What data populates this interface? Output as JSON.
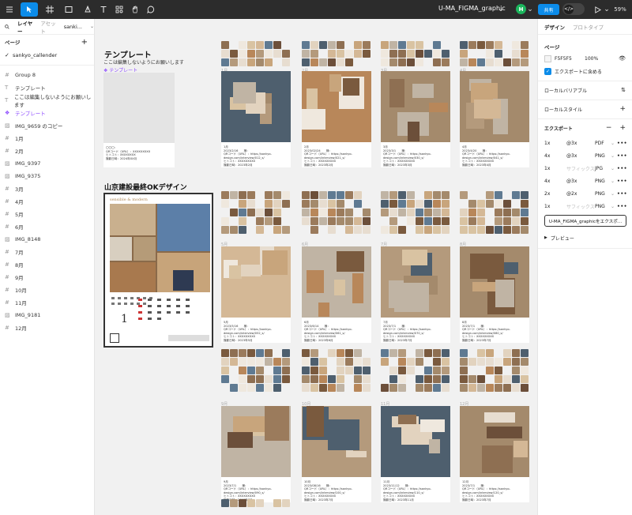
{
  "toolbar": {
    "title": "U-MA_FIGMA_graphic",
    "title_chevron": "⌄",
    "avatar_initial": "H",
    "share_label": "共有",
    "dev_mode_icon": "</>",
    "zoom": "59%",
    "tools": [
      "move-tool",
      "frame-tool",
      "shape-tool",
      "pen-tool",
      "text-tool",
      "resources-tool",
      "hand-tool",
      "comment-tool"
    ]
  },
  "left_panel": {
    "tab_layers": "レイヤー",
    "tab_assets": "アセット",
    "page_selector": "sanki...",
    "pages_header": "ページ",
    "pages": [
      "sankyo_callender"
    ],
    "layers": [
      {
        "icon": "frame",
        "label": "Group 8"
      },
      {
        "icon": "text",
        "label": "テンプレート"
      },
      {
        "icon": "text",
        "label": "ここは編集しないようにお願いします"
      },
      {
        "icon": "component",
        "label": "テンプレート"
      },
      {
        "icon": "image",
        "label": "IMG_9659 のコピー"
      },
      {
        "icon": "frame",
        "label": "1月"
      },
      {
        "icon": "frame",
        "label": "2月"
      },
      {
        "icon": "image",
        "label": "IMG_9397"
      },
      {
        "icon": "image",
        "label": "IMG_9375"
      },
      {
        "icon": "frame",
        "label": "3月"
      },
      {
        "icon": "frame",
        "label": "4月"
      },
      {
        "icon": "frame",
        "label": "5月"
      },
      {
        "icon": "frame",
        "label": "6月"
      },
      {
        "icon": "image",
        "label": "IMG_8148"
      },
      {
        "icon": "frame",
        "label": "7月"
      },
      {
        "icon": "frame",
        "label": "8月"
      },
      {
        "icon": "frame",
        "label": "9月"
      },
      {
        "icon": "frame",
        "label": "10月"
      },
      {
        "icon": "frame",
        "label": "11月"
      },
      {
        "icon": "image",
        "label": "IMG_9181"
      },
      {
        "icon": "frame",
        "label": "12月"
      }
    ]
  },
  "canvas": {
    "template_title": "テンプレート",
    "template_subtitle": "ここは編集しないようにお願いします",
    "template_component_label": "テンプレート",
    "template_info": [
      "〇〇〇：",
      "QRコード（URL）：XXXXXXXXX",
      "ヒトコト：XXXXXXXX",
      "撮影日時：2024年XX月"
    ],
    "final_design_title": "山京建設最終OKデザイン",
    "preview_brand": "sensible & modern",
    "preview_big_day": "1",
    "months": [
      {
        "label": "1月",
        "info": [
          "1月",
          "2023/2/16　　様：",
          "QRコード（URL）：https://sankyo-",
          "design.com/interview/012_s/",
          "ヒトコト：XXXXXXXXX",
          "撮影日時：2023年2月"
        ]
      },
      {
        "label": "2月",
        "info": [
          "2月",
          "2023/02/24　　様：",
          "QRコード（URL）：https://sankyo-",
          "design.com/interview/021_s/",
          "ヒトコト：XXXXXXXXX",
          "撮影日時：2023年2月"
        ]
      },
      {
        "label": "3月",
        "info": [
          "3月",
          "2023/3/1　　様：",
          "QRコード（URL）：https://sankyo-",
          "design.com/interview/030_s/",
          "ヒトコト：XXXXXXXXX",
          "撮影日時：2023年3月"
        ]
      },
      {
        "label": "4月",
        "info": [
          "4月",
          "2023/4/20　　様：",
          "QRコード（URL）：https://sankyo-",
          "design.com/interview/041_s/",
          "ヒトコト：XXXXXXXXX",
          "撮影日時：2023年4月"
        ]
      },
      {
        "label": "5月",
        "info": [
          "5月",
          "2023/5/16　　様：",
          "QRコード（URL）：https://sankyo-",
          "design.com/interview/052_s/",
          "ヒトコト：XXXXXXXXX",
          "撮影日時：2023年5月"
        ]
      },
      {
        "label": "6月",
        "info": [
          "6月",
          "2023/6/14　　様：",
          "QRコード（URL）：https://sankyo-",
          "design.com/interview/061_s/",
          "ヒトコト：XXXXXXXXX",
          "撮影日時：2023年6月"
        ]
      },
      {
        "label": "7月",
        "info": [
          "7月",
          "2023/7/1　　様：",
          "QRコード（URL）：https://sankyo-",
          "design.com/interview/070_s/",
          "ヒトコト：XXXXXXXXX",
          "撮影日時：2023年7月"
        ]
      },
      {
        "label": "8月",
        "info": [
          "8月",
          "2023/7/1　　様：",
          "QRコード（URL）：https://sankyo-",
          "design.com/interview/080_s/",
          "ヒトコト：XXXXXXXXX",
          "撮影日時：2023年7月"
        ]
      },
      {
        "label": "9月",
        "info": [
          "9月",
          "2023/7/1　　様：",
          "QRコード（URL）：https://sankyo-",
          "design.com/interview/090_s/",
          "ヒトコト：XXXXXXXXX",
          "撮影日時：2023年7月"
        ]
      },
      {
        "label": "10月",
        "info": [
          "10月",
          "2023/08/16　　様：",
          "QRコード（URL）：https://sankyo-",
          "design.com/interview/100_s/",
          "ヒトコト：XXXXXXXXX",
          "撮影日時：2023年7月"
        ]
      },
      {
        "label": "11月",
        "info": [
          "11月",
          "2023/11/12　　様：",
          "QRコード（URL）：https://sankyo-",
          "design.com/interview/110_s/",
          "ヒトコト：XXXXXXXXX",
          "撮影日時：2023年11月"
        ]
      },
      {
        "label": "12月",
        "info": [
          "12月",
          "2023/7/1　　様：",
          "QRコード（URL）：https://sankyo-",
          "design.com/interview/120_s/",
          "ヒトコト：XXXXXXXXX",
          "撮影日時：2023年7月"
        ]
      }
    ]
  },
  "right_panel": {
    "tab_design": "デザイン",
    "tab_prototype": "プロトタイプ",
    "page_section": "ページ",
    "bg_color": "F5F5F5",
    "bg_opacity": "100%",
    "include_export_label": "エクスポートに含める",
    "local_variables": "ローカルバリアブル",
    "local_styles": "ローカルスタイル",
    "export_section": "エクスポート",
    "export_rows": [
      {
        "scale": "1x",
        "suffix": "@3x",
        "format": "PDF"
      },
      {
        "scale": "4x",
        "suffix": "@3x",
        "format": "PNG"
      },
      {
        "scale": "1x",
        "suffix": "サフィックス",
        "format": "JPG"
      },
      {
        "scale": "4x",
        "suffix": "@3x",
        "format": "PNG"
      },
      {
        "scale": "2x",
        "suffix": "@2x",
        "format": "PNG"
      },
      {
        "scale": "1x",
        "suffix": "サフィックス",
        "format": "PNG"
      }
    ],
    "export_button": "U-MA_FIGMA_graphicをエクスポ...",
    "preview_label": "プレビュー"
  },
  "colors": {
    "toolbar_bg": "#2c2c2c",
    "accent_blue": "#0c8ce9",
    "component_purple": "#8b48ff",
    "canvas_bg": "#f1f1f1",
    "avatar_green": "#1bb55c"
  }
}
